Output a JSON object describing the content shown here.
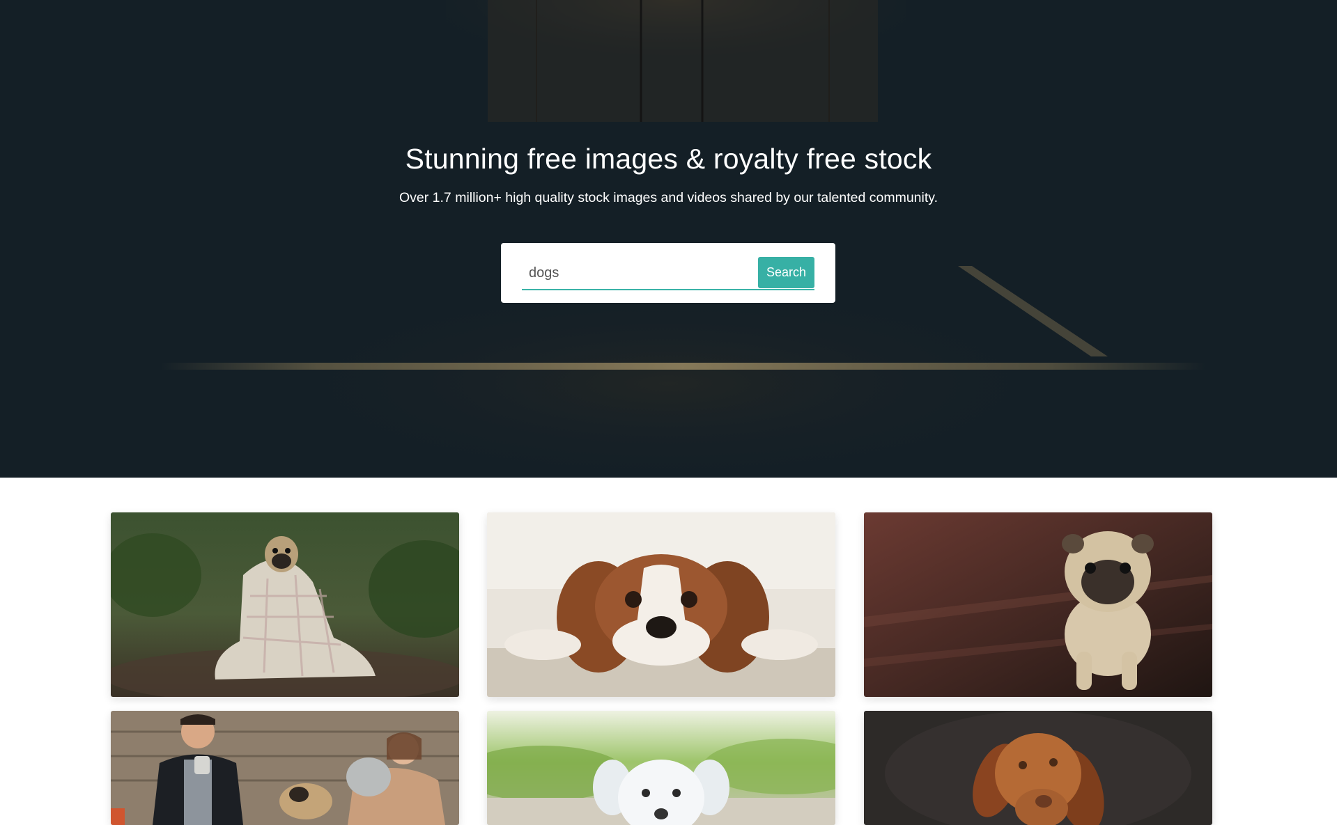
{
  "hero": {
    "title": "Stunning free images & royalty free stock",
    "subtitle": "Over 1.7 million+ high quality stock images and videos shared by our talented community."
  },
  "search": {
    "value": "dogs",
    "button_label": "Search"
  },
  "gallery": {
    "images": [
      {
        "subject": "pug-wrapped-in-blanket-in-forest"
      },
      {
        "subject": "spaniel-puppy-lying-on-carpet"
      },
      {
        "subject": "pug-puppy-on-wooden-floor"
      },
      {
        "subject": "couple-with-pug-on-bench"
      },
      {
        "subject": "white-puppy-on-grass"
      },
      {
        "subject": "vizsla-dog-tilting-head"
      }
    ]
  },
  "colors": {
    "hero_background": "#141f26",
    "accent": "#37b0a5",
    "page_background": "#ffffff"
  }
}
